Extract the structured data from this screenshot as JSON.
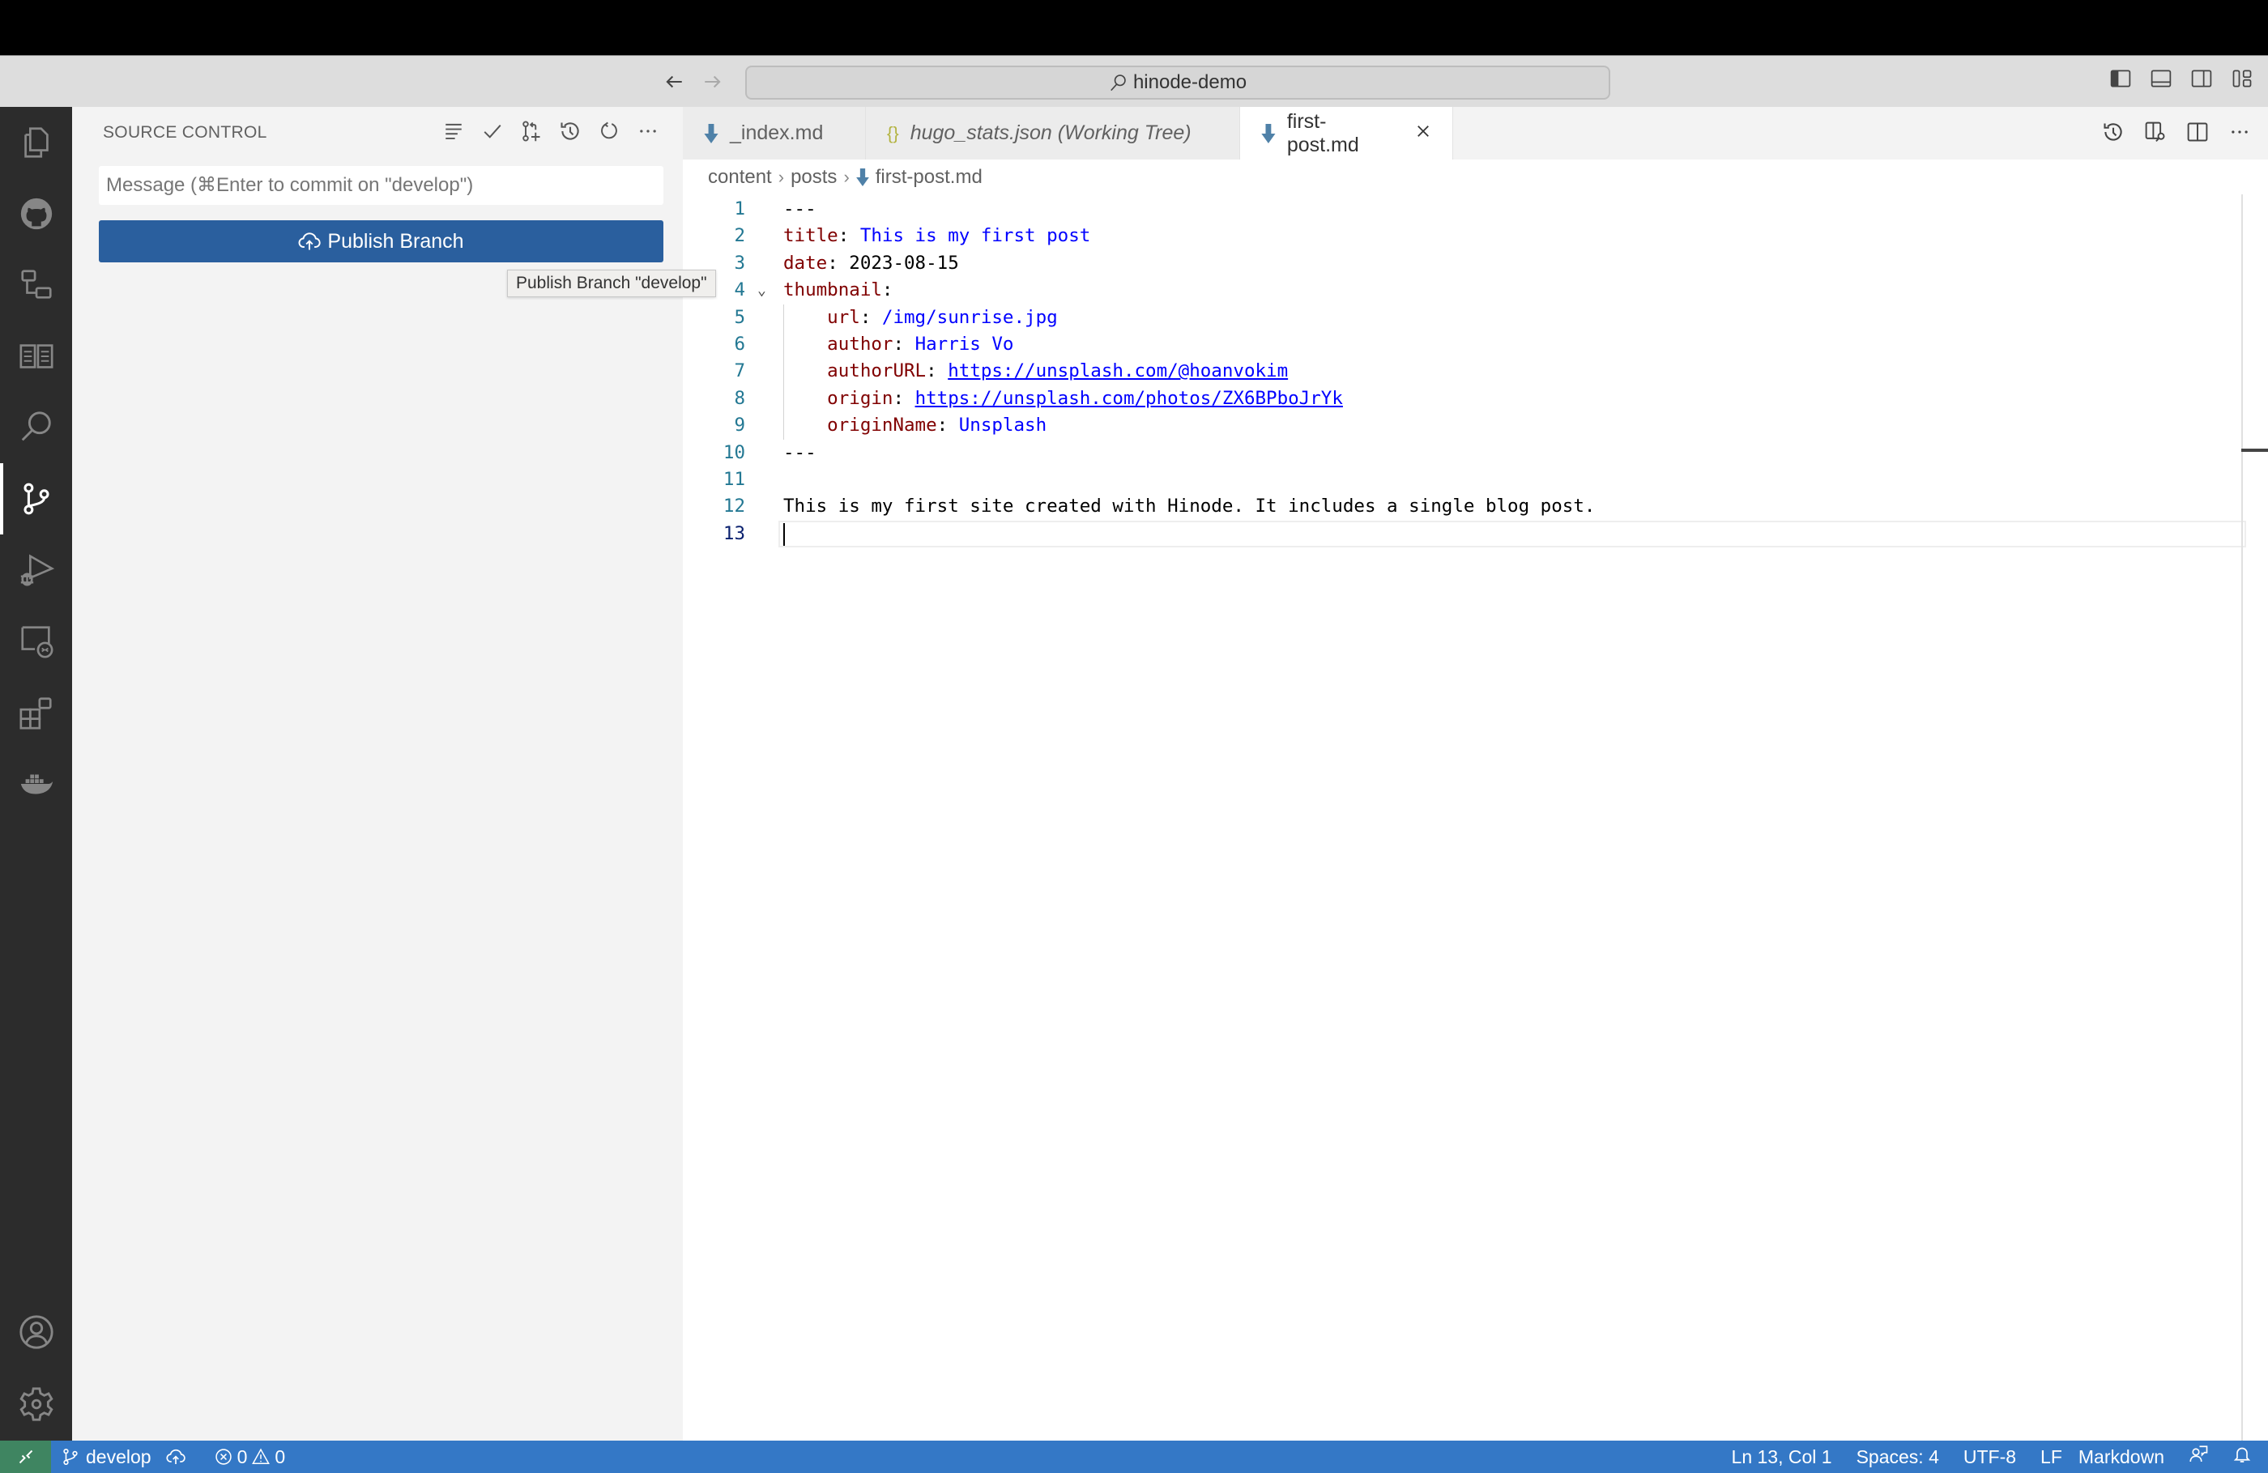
{
  "window": {
    "command_center": "hinode-demo"
  },
  "activity_bar": {
    "items": [
      {
        "name": "explorer",
        "icon": "files-icon"
      },
      {
        "name": "github",
        "icon": "github-icon"
      },
      {
        "name": "remote-explorer",
        "icon": "remote-explorer-icon"
      },
      {
        "name": "documentation",
        "icon": "book-icon"
      },
      {
        "name": "search",
        "icon": "search-icon"
      },
      {
        "name": "source-control",
        "icon": "source-control-icon",
        "active": true
      },
      {
        "name": "run-debug",
        "icon": "run-debug-icon"
      },
      {
        "name": "remote-desktop",
        "icon": "remote-desktop-icon"
      },
      {
        "name": "extensions",
        "icon": "extensions-icon"
      },
      {
        "name": "docker",
        "icon": "docker-icon"
      }
    ],
    "bottom": [
      {
        "name": "accounts",
        "icon": "account-icon"
      },
      {
        "name": "manage",
        "icon": "gear-icon"
      }
    ]
  },
  "sidebar": {
    "title": "SOURCE CONTROL",
    "commit_placeholder": "Message (⌘Enter to commit on \"develop\")",
    "commit_value": "",
    "publish_label": "Publish Branch",
    "tooltip": "Publish Branch \"develop\""
  },
  "tabs": [
    {
      "label": "_index.md",
      "icon": "markdown-icon",
      "italic": false,
      "active": false
    },
    {
      "label": "hugo_stats.json (Working Tree)",
      "icon": "json-icon",
      "italic": true,
      "active": false
    },
    {
      "label": "first-post.md",
      "icon": "markdown-icon",
      "italic": false,
      "active": true
    }
  ],
  "breadcrumb": [
    "content",
    "posts",
    "first-post.md"
  ],
  "editor": {
    "lines": [
      {
        "n": "1",
        "segments": [
          {
            "t": "---",
            "c": "plain"
          }
        ]
      },
      {
        "n": "2",
        "segments": [
          {
            "t": "title",
            "c": "key"
          },
          {
            "t": ": ",
            "c": "plain"
          },
          {
            "t": "This is my first post",
            "c": "val"
          }
        ]
      },
      {
        "n": "3",
        "segments": [
          {
            "t": "date",
            "c": "key"
          },
          {
            "t": ": 2023-08-15",
            "c": "plain"
          }
        ]
      },
      {
        "n": "4",
        "segments": [
          {
            "t": "thumbnail",
            "c": "key"
          },
          {
            "t": ":",
            "c": "plain"
          }
        ],
        "fold": true
      },
      {
        "n": "5",
        "segments": [
          {
            "t": "    url",
            "c": "key"
          },
          {
            "t": ": ",
            "c": "plain"
          },
          {
            "t": "/img/sunrise.jpg",
            "c": "val"
          }
        ],
        "guide": true
      },
      {
        "n": "6",
        "segments": [
          {
            "t": "    author",
            "c": "key"
          },
          {
            "t": ": ",
            "c": "plain"
          },
          {
            "t": "Harris Vo",
            "c": "val"
          }
        ],
        "guide": true
      },
      {
        "n": "7",
        "segments": [
          {
            "t": "    authorURL",
            "c": "key"
          },
          {
            "t": ": ",
            "c": "plain"
          },
          {
            "t": "https://unsplash.com/@hoanvokim",
            "c": "link"
          }
        ],
        "guide": true
      },
      {
        "n": "8",
        "segments": [
          {
            "t": "    origin",
            "c": "key"
          },
          {
            "t": ": ",
            "c": "plain"
          },
          {
            "t": "https://unsplash.com/photos/ZX6BPboJrYk",
            "c": "link"
          }
        ],
        "guide": true
      },
      {
        "n": "9",
        "segments": [
          {
            "t": "    originName",
            "c": "key"
          },
          {
            "t": ": ",
            "c": "plain"
          },
          {
            "t": "Unsplash",
            "c": "val"
          }
        ],
        "guide": true
      },
      {
        "n": "10",
        "segments": [
          {
            "t": "---",
            "c": "plain"
          }
        ]
      },
      {
        "n": "11",
        "segments": []
      },
      {
        "n": "12",
        "segments": [
          {
            "t": "This is my first site created with Hinode. It includes a single blog post.",
            "c": "plain"
          }
        ]
      },
      {
        "n": "13",
        "segments": [],
        "current": true
      }
    ]
  },
  "statusbar": {
    "branch": "develop",
    "errors": "0",
    "warnings": "0",
    "position": "Ln 13, Col 1",
    "indent": "Spaces: 4",
    "encoding": "UTF-8",
    "eol": "LF",
    "language": "Markdown"
  }
}
